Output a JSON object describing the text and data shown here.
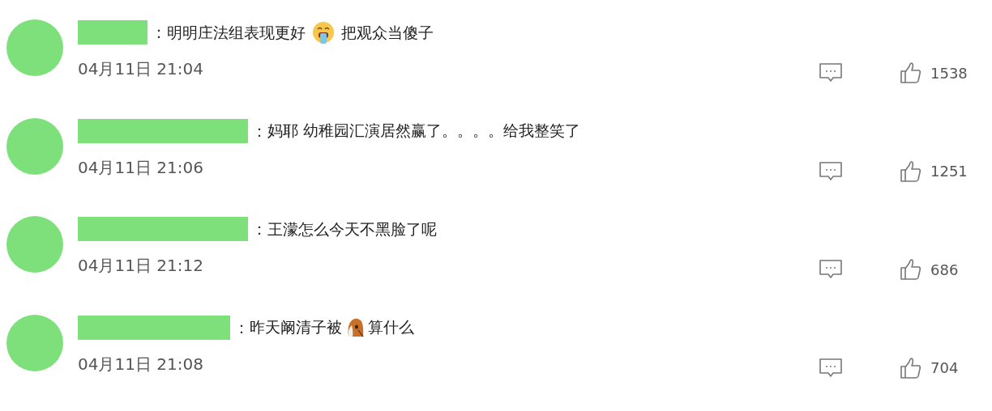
{
  "comments": [
    {
      "separator": "：",
      "text_before": "明明庄法组表现更好",
      "emoji": {
        "kind": "crying-face"
      },
      "text_after": "把观众当傻子",
      "time": "04月11日 21:04",
      "likes": "1538"
    },
    {
      "separator": "：",
      "text_before": "妈耶 幼稚园汇演居然赢了。。。。给我整笑了",
      "time": "04月11日 21:06",
      "likes": "1251"
    },
    {
      "separator": "：",
      "text_before": "王濛怎么今天不黑脸了呢",
      "time": "04月11日 21:12",
      "likes": "686"
    },
    {
      "separator": "：",
      "text_before": "昨天阚清子被",
      "emoji": {
        "kind": "animal-head"
      },
      "text_after": "算什么",
      "time": "04月11日 21:08",
      "likes": "704"
    }
  ]
}
